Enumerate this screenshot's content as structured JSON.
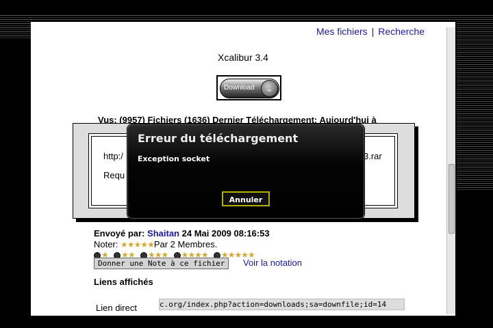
{
  "header": {
    "link_files": "Mes fichiers",
    "separator": "|",
    "link_search": "Recherche"
  },
  "page": {
    "title": "Xcalibur 3.4",
    "download_label": "Download",
    "stats": "Vus: (9957)  Fichiers (1636)  Dernier Téléchargement: Aujourd'hui à",
    "box_url_start": "http:/",
    "box_url_end": "3.rar",
    "box_req": "Requ"
  },
  "dialog": {
    "title": "Erreur du téléchargement",
    "message": "Exception socket",
    "cancel_label": "Annuler"
  },
  "info": {
    "sent_label": "Envoyé par:",
    "user": "Shaitan",
    "date": "24 Mai 2009 08:16:53",
    "noter_label": "Noter:",
    "noter_suffix": "Par 2 Membres.",
    "rate_button": "Donner une Note à ce fichier",
    "voir_link": "Voir la notation",
    "liens_heading": "Liens affichés",
    "lien_label": "Lien direct",
    "lien_url": "c.org/index.php?action=downloads;sa=downfile;id=14"
  },
  "rating": {
    "stars_filled": 5,
    "stars_total": 5
  },
  "colors": {
    "link": "#1a1aa6",
    "dialog_bg": "#000000",
    "dialog_button_border": "#b0b400",
    "star": "#d4a830"
  },
  "icons": {
    "download": "chevron-down-icon",
    "star": "star-icon"
  }
}
